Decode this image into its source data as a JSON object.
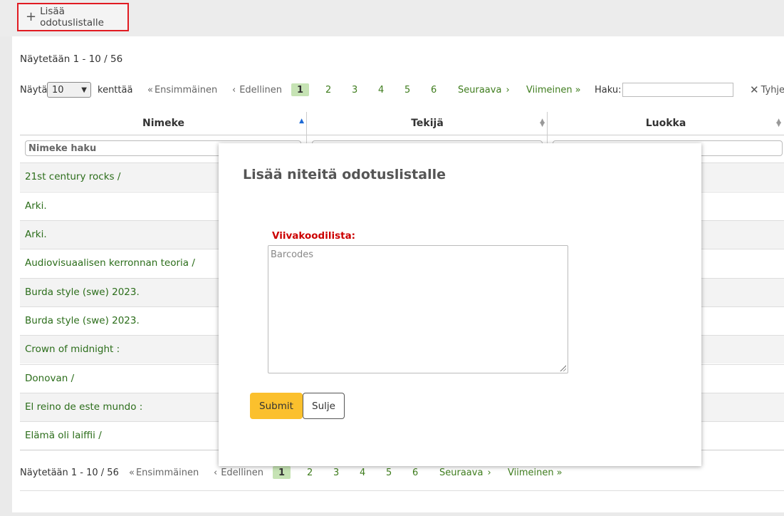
{
  "toolbar": {
    "add_waiting_list": "Lisää odotuslistalle"
  },
  "table_info": {
    "top": "Näytetään 1 - 10 / 56",
    "bottom": "Näytetään 1 - 10 / 56"
  },
  "length_control": {
    "show": "Näytä",
    "value": "10",
    "entries": "kenttää"
  },
  "pagination": {
    "first": "Ensimmäinen",
    "previous": "Edellinen",
    "pages": [
      "1",
      "2",
      "3",
      "4",
      "5",
      "6"
    ],
    "current": "1",
    "next": "Seuraava",
    "last": "Viimeinen"
  },
  "search": {
    "label": "Haku:",
    "value": "",
    "clear": "Tyhjennä"
  },
  "columns": [
    "Nimeke",
    "Tekijä",
    "Luokka"
  ],
  "filters": {
    "title_placeholder": "Nimeke haku"
  },
  "rows": [
    "21st century rocks /",
    "Arki.",
    "Arki.",
    "Audiovisuaalisen kerronnan teoria /",
    "Burda style (swe) 2023.",
    "Burda style (swe) 2023.",
    "Crown of midnight :",
    "Donovan /",
    "El reino de este mundo :",
    "Elämä oli laiffii /"
  ],
  "modal": {
    "title": "Lisää niteitä odotuslistalle",
    "barcode_label": "Viivakoodilista:",
    "barcode_placeholder": "Barcodes",
    "submit": "Submit",
    "close": "Sulje"
  },
  "colors": {
    "link": "#2b6d1a",
    "current_page_bg": "#c6e3b4",
    "submit_bg": "#fbc02d",
    "required_label": "#cc0000",
    "highlight_border": "#e11b22"
  }
}
